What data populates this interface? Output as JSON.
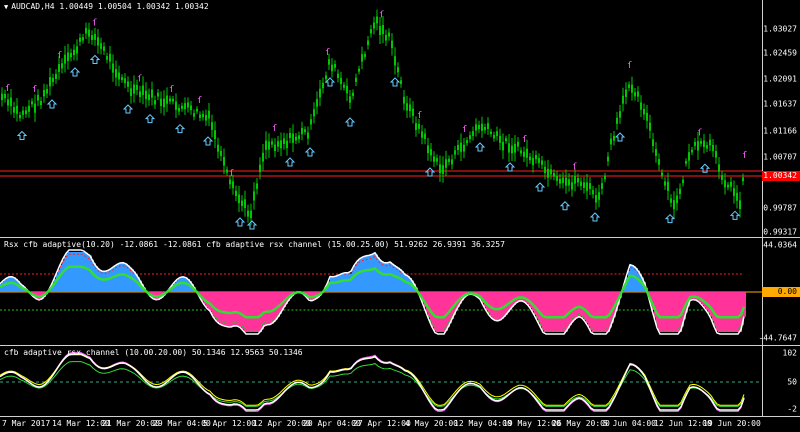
{
  "main": {
    "menu_arrow": "▼",
    "title": "AUDCAD,H4  1.00449 1.00504 1.00342 1.00342",
    "price_levels": [
      "1.03027",
      "1.02459",
      "1.02091",
      "1.01637",
      "1.01166",
      "1.00707",
      "1.00342",
      "0.99787",
      "0.99317"
    ],
    "bid_price": "1.00342",
    "bid_badge_color": "#ff0000",
    "candle_color": "#00c800",
    "up_arrow_color": "#66ccff",
    "down_marker_color": "#ff66ff",
    "level_line_color": "#ff2020"
  },
  "indicator1": {
    "title": "Rsx cfb adaptive(10.20) -12.0861 -12.0861   cfb adaptive rsx channel (15.00.25.00) 51.9262 26.9391 36.3257",
    "levels": [
      "44.0364",
      "0.00",
      "-44.7647"
    ],
    "zero_badge": "0.00",
    "zero_badge_color": "#ffaa00",
    "colors": {
      "pos_fill": "#3399ff",
      "neg_fill": "#ff3399",
      "line_white": "#ffffff",
      "line_green": "#33dd33",
      "channel_red": "#ff2020",
      "channel_green": "#20c020"
    }
  },
  "indicator2": {
    "title": "cfb adaptive rsx channel (10.00.20.00) 50.1346 12.9563 50.1346",
    "levels": [
      "102",
      "50",
      "-2"
    ],
    "colors": {
      "line_white": "#ffffff",
      "line_green": "#33dd33",
      "line_yellow": "#ffff00",
      "line_pink": "#ff66ff",
      "mid_dashed": "#33aa88"
    }
  },
  "x_axis": {
    "labels": [
      "7 Mar 2017",
      "14 Mar 12:00",
      "21 Mar 20:00",
      "29 Mar 04:00",
      "5 Apr 12:00",
      "12 Apr 20:00",
      "20 Apr 04:00",
      "27 Apr 12:00",
      "4 May 20:00",
      "12 May 04:00",
      "19 May 12:00",
      "26 May 20:00",
      "5 Jun 04:00",
      "12 Jun 12:00",
      "19 Jun 20:00"
    ]
  }
}
